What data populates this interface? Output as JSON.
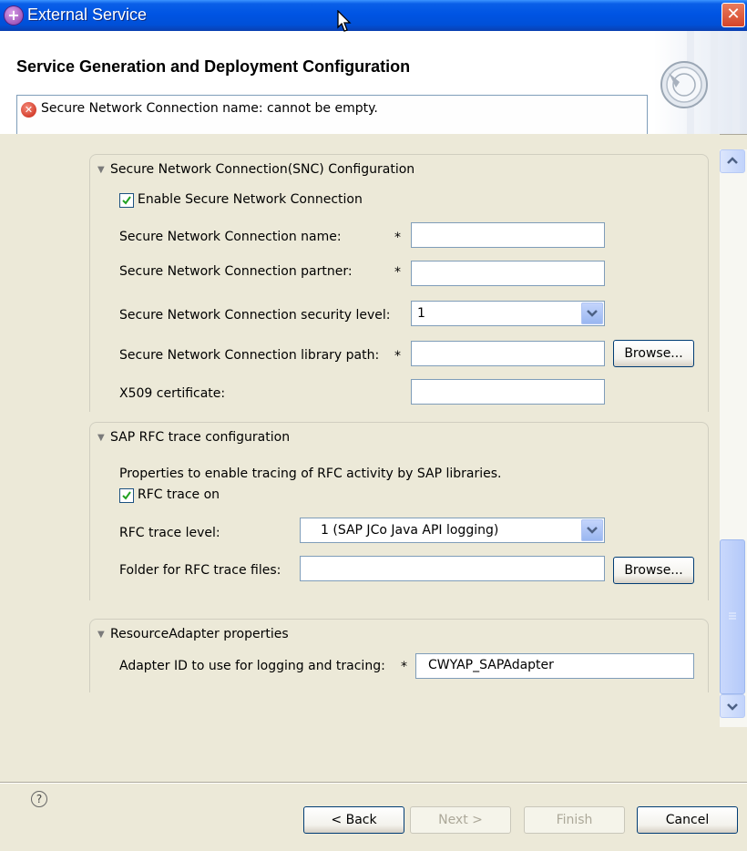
{
  "window": {
    "title": "External Service",
    "close_label": "✕"
  },
  "header": {
    "page_title": "Service Generation and Deployment Configuration",
    "error_message": "Secure Network Connection name: cannot be empty."
  },
  "snc_section": {
    "title": "Secure Network Connection(SNC) Configuration",
    "enable_label": "Enable Secure Network Connection",
    "enable_checked": true,
    "name_label": "Secure Network Connection name:",
    "name_value": "",
    "partner_label": "Secure Network Connection partner:",
    "partner_value": "",
    "security_level_label": "Secure Network Connection security level:",
    "security_level_value": "1",
    "library_path_label": "Secure Network Connection library path:",
    "library_path_value": "",
    "x509_label": "X509 certificate:",
    "x509_value": "",
    "browse_label": "Browse...",
    "required_marker": "*"
  },
  "rfc_section": {
    "title": "SAP RFC trace configuration",
    "description": "Properties to enable tracing of RFC activity by SAP libraries.",
    "trace_on_label": "RFC trace on",
    "trace_on_checked": true,
    "trace_level_label": "RFC trace level:",
    "trace_level_value": "1 (SAP JCo Java API logging)",
    "folder_label": "Folder for RFC trace files:",
    "folder_value": "",
    "browse_label": "Browse..."
  },
  "ra_section": {
    "title": "ResourceAdapter properties",
    "adapter_id_label": "Adapter ID to use for logging and tracing:",
    "adapter_id_value": "CWYAP_SAPAdapter",
    "required_marker": "*"
  },
  "footer": {
    "help_label": "?",
    "back_label": "< Back",
    "next_label": "Next >",
    "finish_label": "Finish",
    "cancel_label": "Cancel"
  }
}
